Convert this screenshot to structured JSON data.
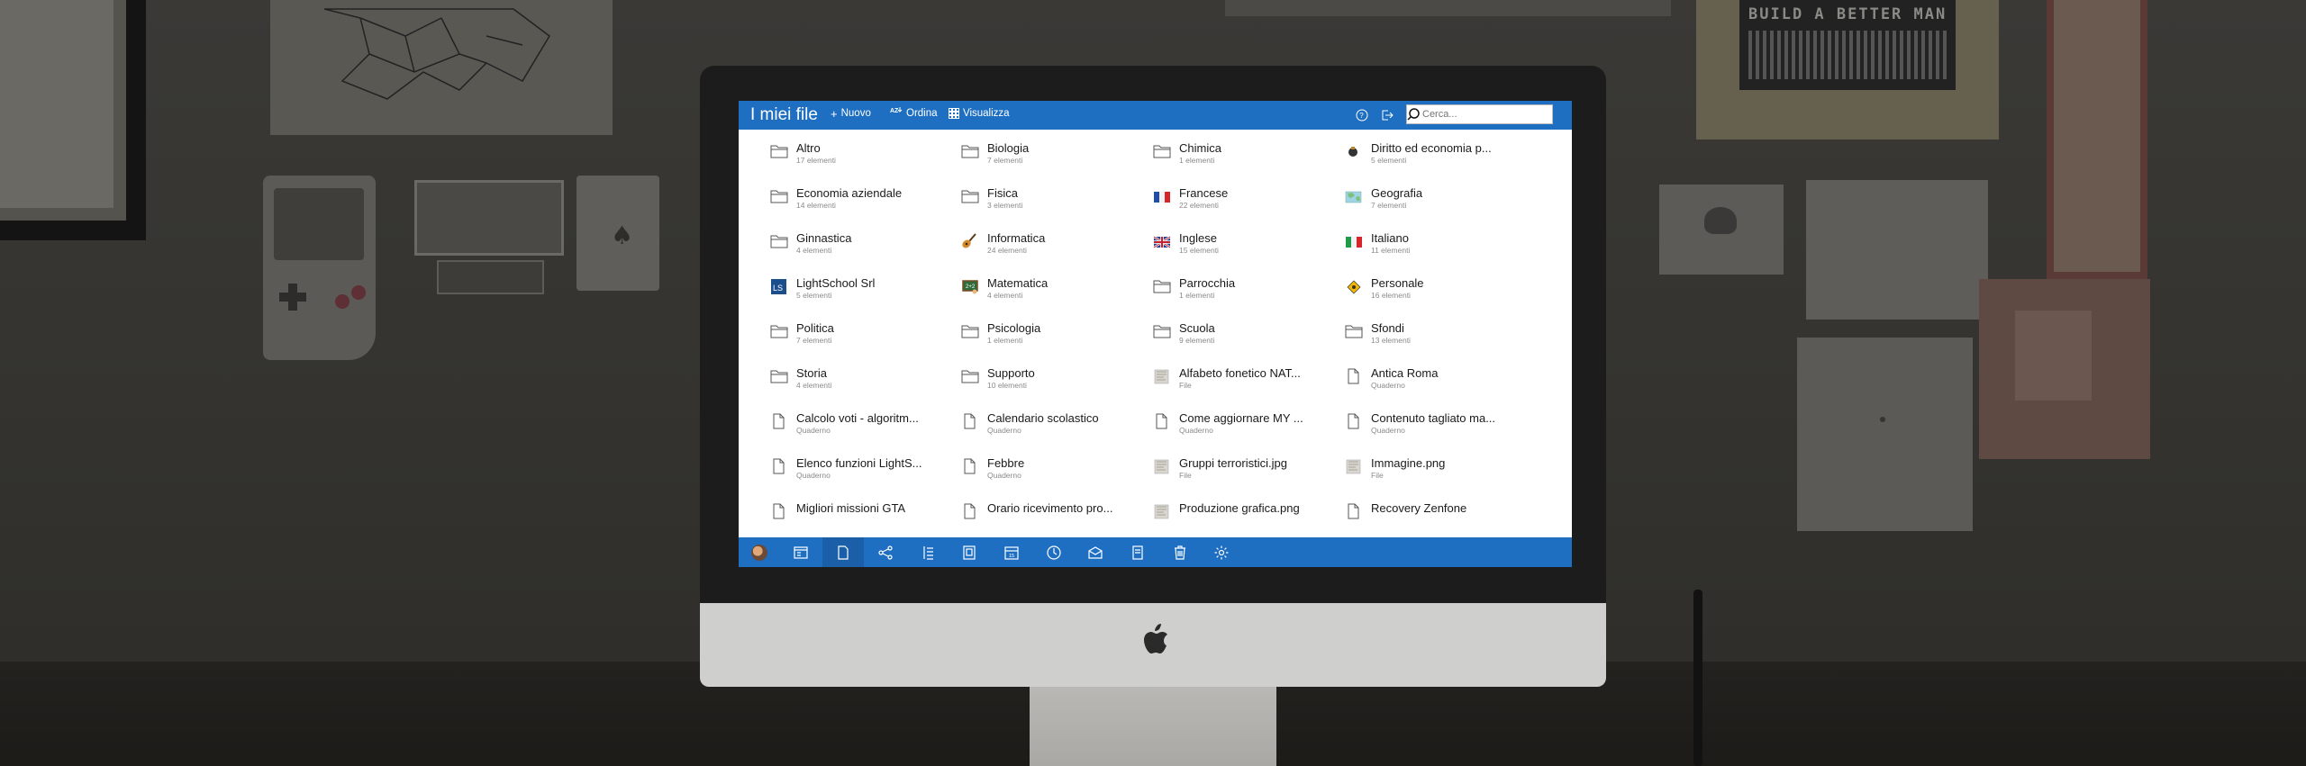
{
  "app": {
    "title": "I miei file",
    "toolbar": {
      "new_label": "Nuovo",
      "sort_label": "Ordina",
      "view_label": "Visualizza"
    },
    "search": {
      "placeholder": "Cerca..."
    },
    "colors": {
      "accent": "#1e6fc2",
      "accent_dark": "#1a5fa7"
    }
  },
  "items": [
    {
      "name": "Altro",
      "sub": "17 elementi",
      "icon": "folder-icon"
    },
    {
      "name": "Biologia",
      "sub": "7 elementi",
      "icon": "folder-icon"
    },
    {
      "name": "Chimica",
      "sub": "1 elementi",
      "icon": "folder-icon"
    },
    {
      "name": "Diritto ed economia p...",
      "sub": "5 elementi",
      "icon": "law-icon"
    },
    {
      "name": "Economia aziendale",
      "sub": "14 elementi",
      "icon": "folder-icon"
    },
    {
      "name": "Fisica",
      "sub": "3 elementi",
      "icon": "folder-icon"
    },
    {
      "name": "Francese",
      "sub": "22 elementi",
      "icon": "france-flag-icon"
    },
    {
      "name": "Geografia",
      "sub": "7 elementi",
      "icon": "map-icon"
    },
    {
      "name": "Ginnastica",
      "sub": "4 elementi",
      "icon": "folder-icon"
    },
    {
      "name": "Informatica",
      "sub": "24 elementi",
      "icon": "guitar-icon"
    },
    {
      "name": "Inglese",
      "sub": "15 elementi",
      "icon": "uk-flag-icon"
    },
    {
      "name": "Italiano",
      "sub": "11 elementi",
      "icon": "italy-flag-icon"
    },
    {
      "name": "LightSchool Srl",
      "sub": "5 elementi",
      "icon": "lightschool-logo-icon"
    },
    {
      "name": "Matematica",
      "sub": "4 elementi",
      "icon": "blackboard-icon"
    },
    {
      "name": "Parrocchia",
      "sub": "1 elementi",
      "icon": "folder-icon"
    },
    {
      "name": "Personale",
      "sub": "16 elementi",
      "icon": "warning-sign-icon"
    },
    {
      "name": "Politica",
      "sub": "7 elementi",
      "icon": "folder-icon"
    },
    {
      "name": "Psicologia",
      "sub": "1 elementi",
      "icon": "folder-icon"
    },
    {
      "name": "Scuola",
      "sub": "9 elementi",
      "icon": "folder-icon"
    },
    {
      "name": "Sfondi",
      "sub": "13 elementi",
      "icon": "folder-icon"
    },
    {
      "name": "Storia",
      "sub": "4 elementi",
      "icon": "folder-icon"
    },
    {
      "name": "Supporto",
      "sub": "10 elementi",
      "icon": "folder-icon"
    },
    {
      "name": "Alfabeto fonetico NAT...",
      "sub": "File",
      "icon": "image-thumbnail-icon"
    },
    {
      "name": "Antica Roma",
      "sub": "Quaderno",
      "icon": "document-icon"
    },
    {
      "name": "Calcolo voti - algoritm...",
      "sub": "Quaderno",
      "icon": "document-icon"
    },
    {
      "name": "Calendario scolastico",
      "sub": "Quaderno",
      "icon": "document-icon"
    },
    {
      "name": "Come aggiornare MY ...",
      "sub": "Quaderno",
      "icon": "document-icon"
    },
    {
      "name": "Contenuto tagliato ma...",
      "sub": "Quaderno",
      "icon": "document-icon"
    },
    {
      "name": "Elenco funzioni LightS...",
      "sub": "Quaderno",
      "icon": "document-icon"
    },
    {
      "name": "Febbre",
      "sub": "Quaderno",
      "icon": "document-icon"
    },
    {
      "name": "Gruppi terroristici.jpg",
      "sub": "File",
      "icon": "image-thumbnail-icon"
    },
    {
      "name": "Immagine.png",
      "sub": "File",
      "icon": "image-thumbnail-icon"
    },
    {
      "name": "Migliori missioni GTA",
      "sub": "",
      "icon": "document-icon"
    },
    {
      "name": "Orario ricevimento pro...",
      "sub": "",
      "icon": "document-icon"
    },
    {
      "name": "Produzione grafica.png",
      "sub": "",
      "icon": "image-thumbnail-icon"
    },
    {
      "name": "Recovery Zenfone",
      "sub": "",
      "icon": "document-icon"
    }
  ],
  "bottom_nav": [
    {
      "name": "user-avatar",
      "active": false
    },
    {
      "name": "desktop-icon",
      "active": false
    },
    {
      "name": "files-icon",
      "active": true
    },
    {
      "name": "share-icon",
      "active": false
    },
    {
      "name": "diary-icon",
      "active": false
    },
    {
      "name": "contacts-icon",
      "active": false
    },
    {
      "name": "calendar-icon",
      "active": false
    },
    {
      "name": "timetable-icon",
      "active": false
    },
    {
      "name": "messages-icon",
      "active": false
    },
    {
      "name": "notes-icon",
      "active": false
    },
    {
      "name": "trash-icon",
      "active": false
    },
    {
      "name": "settings-icon",
      "active": false
    }
  ]
}
